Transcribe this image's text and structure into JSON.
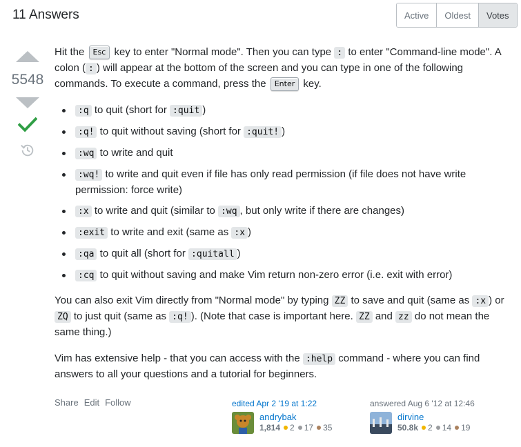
{
  "header": {
    "answers_title": "11 Answers",
    "sort_options": [
      {
        "label": "Active",
        "selected": false
      },
      {
        "label": "Oldest",
        "selected": false
      },
      {
        "label": "Votes",
        "selected": true
      }
    ]
  },
  "vote": {
    "count": "5548",
    "up_icon": "upvote-arrow-icon",
    "down_icon": "downvote-arrow-icon",
    "accepted_icon": "checkmark-icon",
    "history_icon": "history-icon",
    "accent_color": "#2f9e44"
  },
  "post": {
    "intro": {
      "t1": "Hit the",
      "kbd_esc": "Esc",
      "t2": "key to enter \"Normal mode\". Then you can type",
      "colon": ":",
      "t3": "to enter \"Command-line mode\". A colon (",
      "colon2": ":",
      "t4": ") will appear at the bottom of the screen and you can type in one of the following commands. To execute a command, press the",
      "kbd_enter": "Enter",
      "t5": "key."
    },
    "commands": [
      {
        "code": ":q",
        "text": " to quit (short for ",
        "code2": ":quit",
        "text2": ")"
      },
      {
        "code": ":q!",
        "text": " to quit without saving (short for ",
        "code2": ":quit!",
        "text2": ")"
      },
      {
        "code": ":wq",
        "text": " to write and quit",
        "code2": "",
        "text2": ""
      },
      {
        "code": ":wq!",
        "text": " to write and quit even if file has only read permission (if file does not have write permission: force write)",
        "code2": "",
        "text2": ""
      },
      {
        "code": ":x",
        "text": " to write and quit (similar to ",
        "code2": ":wq",
        "text2": ", but only write if there are changes)"
      },
      {
        "code": ":exit",
        "text": " to write and exit (same as ",
        "code2": ":x",
        "text2": ")"
      },
      {
        "code": ":qa",
        "text": " to quit all (short for ",
        "code2": ":quitall",
        "text2": ")"
      },
      {
        "code": ":cq",
        "text": " to quit without saving and make Vim return non-zero error (i.e. exit with error)",
        "code2": "",
        "text2": ""
      }
    ],
    "exit_para": {
      "t1": "You can also exit Vim directly from \"Normal mode\" by typing",
      "c1": "ZZ",
      "t2": "to save and quit (same as",
      "c2": ":x",
      "t3": ") or",
      "c3": "ZQ",
      "t4": "to just quit (same as",
      "c4": ":q!",
      "t5": "). (Note that case is important here.",
      "c5": "ZZ",
      "t6": "and",
      "c6": "zz",
      "t7": "do not mean the same thing.)"
    },
    "help_para": {
      "t1": "Vim has extensive help - that you can access with the",
      "c1": ":help",
      "t2": "command - where you can find answers to all your questions and a tutorial for beginners."
    }
  },
  "menu": {
    "share": "Share",
    "edit": "Edit",
    "follow": "Follow"
  },
  "editor": {
    "action": "edited Apr 2 '19 at 1:22",
    "name": "andrybak",
    "rep": "1,814",
    "gold": "2",
    "silver": "17",
    "bronze": "35"
  },
  "author": {
    "action": "answered Aug 6 '12 at 12:46",
    "name": "dirvine",
    "rep": "50.8k",
    "gold": "2",
    "silver": "14",
    "bronze": "19"
  },
  "colors": {
    "gold": "#f1b600",
    "silver": "#9a9c9f",
    "bronze": "#ab825f",
    "link": "#0074cc"
  }
}
